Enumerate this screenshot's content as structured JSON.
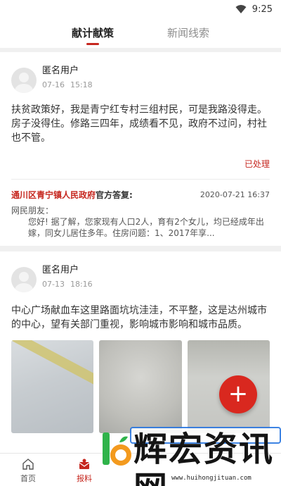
{
  "status_bar": {
    "time": "9:25"
  },
  "tabs": [
    {
      "label": "献计献策",
      "active": true
    },
    {
      "label": "新闻线索",
      "active": false
    }
  ],
  "posts": [
    {
      "user": "匿名用户",
      "date": "07-16",
      "time": "15:18",
      "body": "扶贫政策好，我是青宁红专村三组村民，可是我路没得走。房子没得住。修路三四年，成绩看不见，政府不过问，村社也不管。",
      "status": "已处理",
      "reply": {
        "org": "通川区青宁镇人民政府",
        "suffix": "官方答复:",
        "date": "2020-07-21 16:37",
        "greeting": "网民朋友：",
        "body": "您好! 据了解，您家现有人口2人，育有2个女儿，均已经成年出嫁，同女儿居住多年。住房问题：1、2017年享..."
      }
    },
    {
      "user": "匿名用户",
      "date": "07-13",
      "time": "18:16",
      "body": "中心广场献血车这里路面坑坑洼洼，不平整，这是达州城市的中心，望有关部门重视，影响城市影响和城市品质。"
    }
  ],
  "fab": {
    "label": "+"
  },
  "bottom_nav": [
    {
      "label": "首页",
      "icon": "home-icon",
      "active": false
    },
    {
      "label": "报料",
      "icon": "report-icon",
      "active": true
    }
  ],
  "watermark": {
    "text": "辉宏资讯网",
    "url": "www.huihongjituan.com"
  },
  "colors": {
    "accent": "#c6271f",
    "fab": "#d9281f"
  }
}
